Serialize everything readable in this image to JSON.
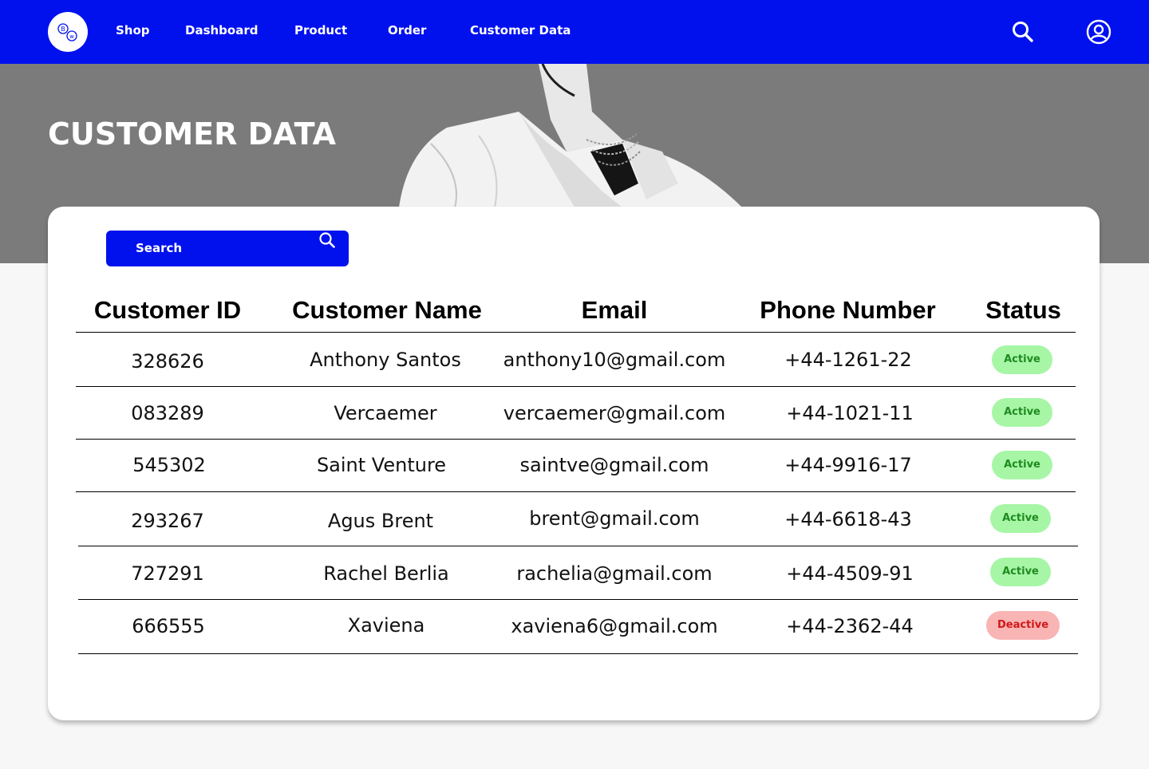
{
  "nav": {
    "links": [
      "Shop",
      "Dashboard",
      "Product",
      "Order",
      "Customer Data"
    ],
    "logo_icon": "bw-logo-icon",
    "search_icon": "search-icon",
    "user_icon": "user-account-icon"
  },
  "hero": {
    "title": "CUSTOMER DATA"
  },
  "search": {
    "label": "Search"
  },
  "table": {
    "headers": [
      "Customer ID",
      "Customer Name",
      "Email",
      "Phone Number",
      "Status"
    ],
    "rows": [
      {
        "id": "328626",
        "name": "Anthony Santos",
        "email": "anthony10@gmail.com",
        "phone": "+44-1261-22",
        "status": "Active"
      },
      {
        "id": "083289",
        "name": "Vercaemer",
        "email": "vercaemer@gmail.com",
        "phone": "+44-1021-11",
        "status": "Active"
      },
      {
        "id": "545302",
        "name": "Saint Venture",
        "email": "saintve@gmail.com",
        "phone": "+44-9916-17",
        "status": "Active"
      },
      {
        "id": "293267",
        "name": "Agus Brent",
        "email": "brent@gmail.com",
        "phone": "+44-6618-43",
        "status": "Active"
      },
      {
        "id": "727291",
        "name": "Rachel Berlia",
        "email": "rachelia@gmail.com",
        "phone": "+44-4509-91",
        "status": "Active"
      },
      {
        "id": "666555",
        "name": "Xaviena",
        "email": "xaviena6@gmail.com",
        "phone": "+44-2362-44",
        "status": "Deactive"
      }
    ]
  },
  "colors": {
    "primary": "#0011ee",
    "active_bg": "#a6f6a6",
    "active_text": "#1f8a1f",
    "deactive_bg": "#f9b4b4",
    "deactive_text": "#d01818"
  }
}
